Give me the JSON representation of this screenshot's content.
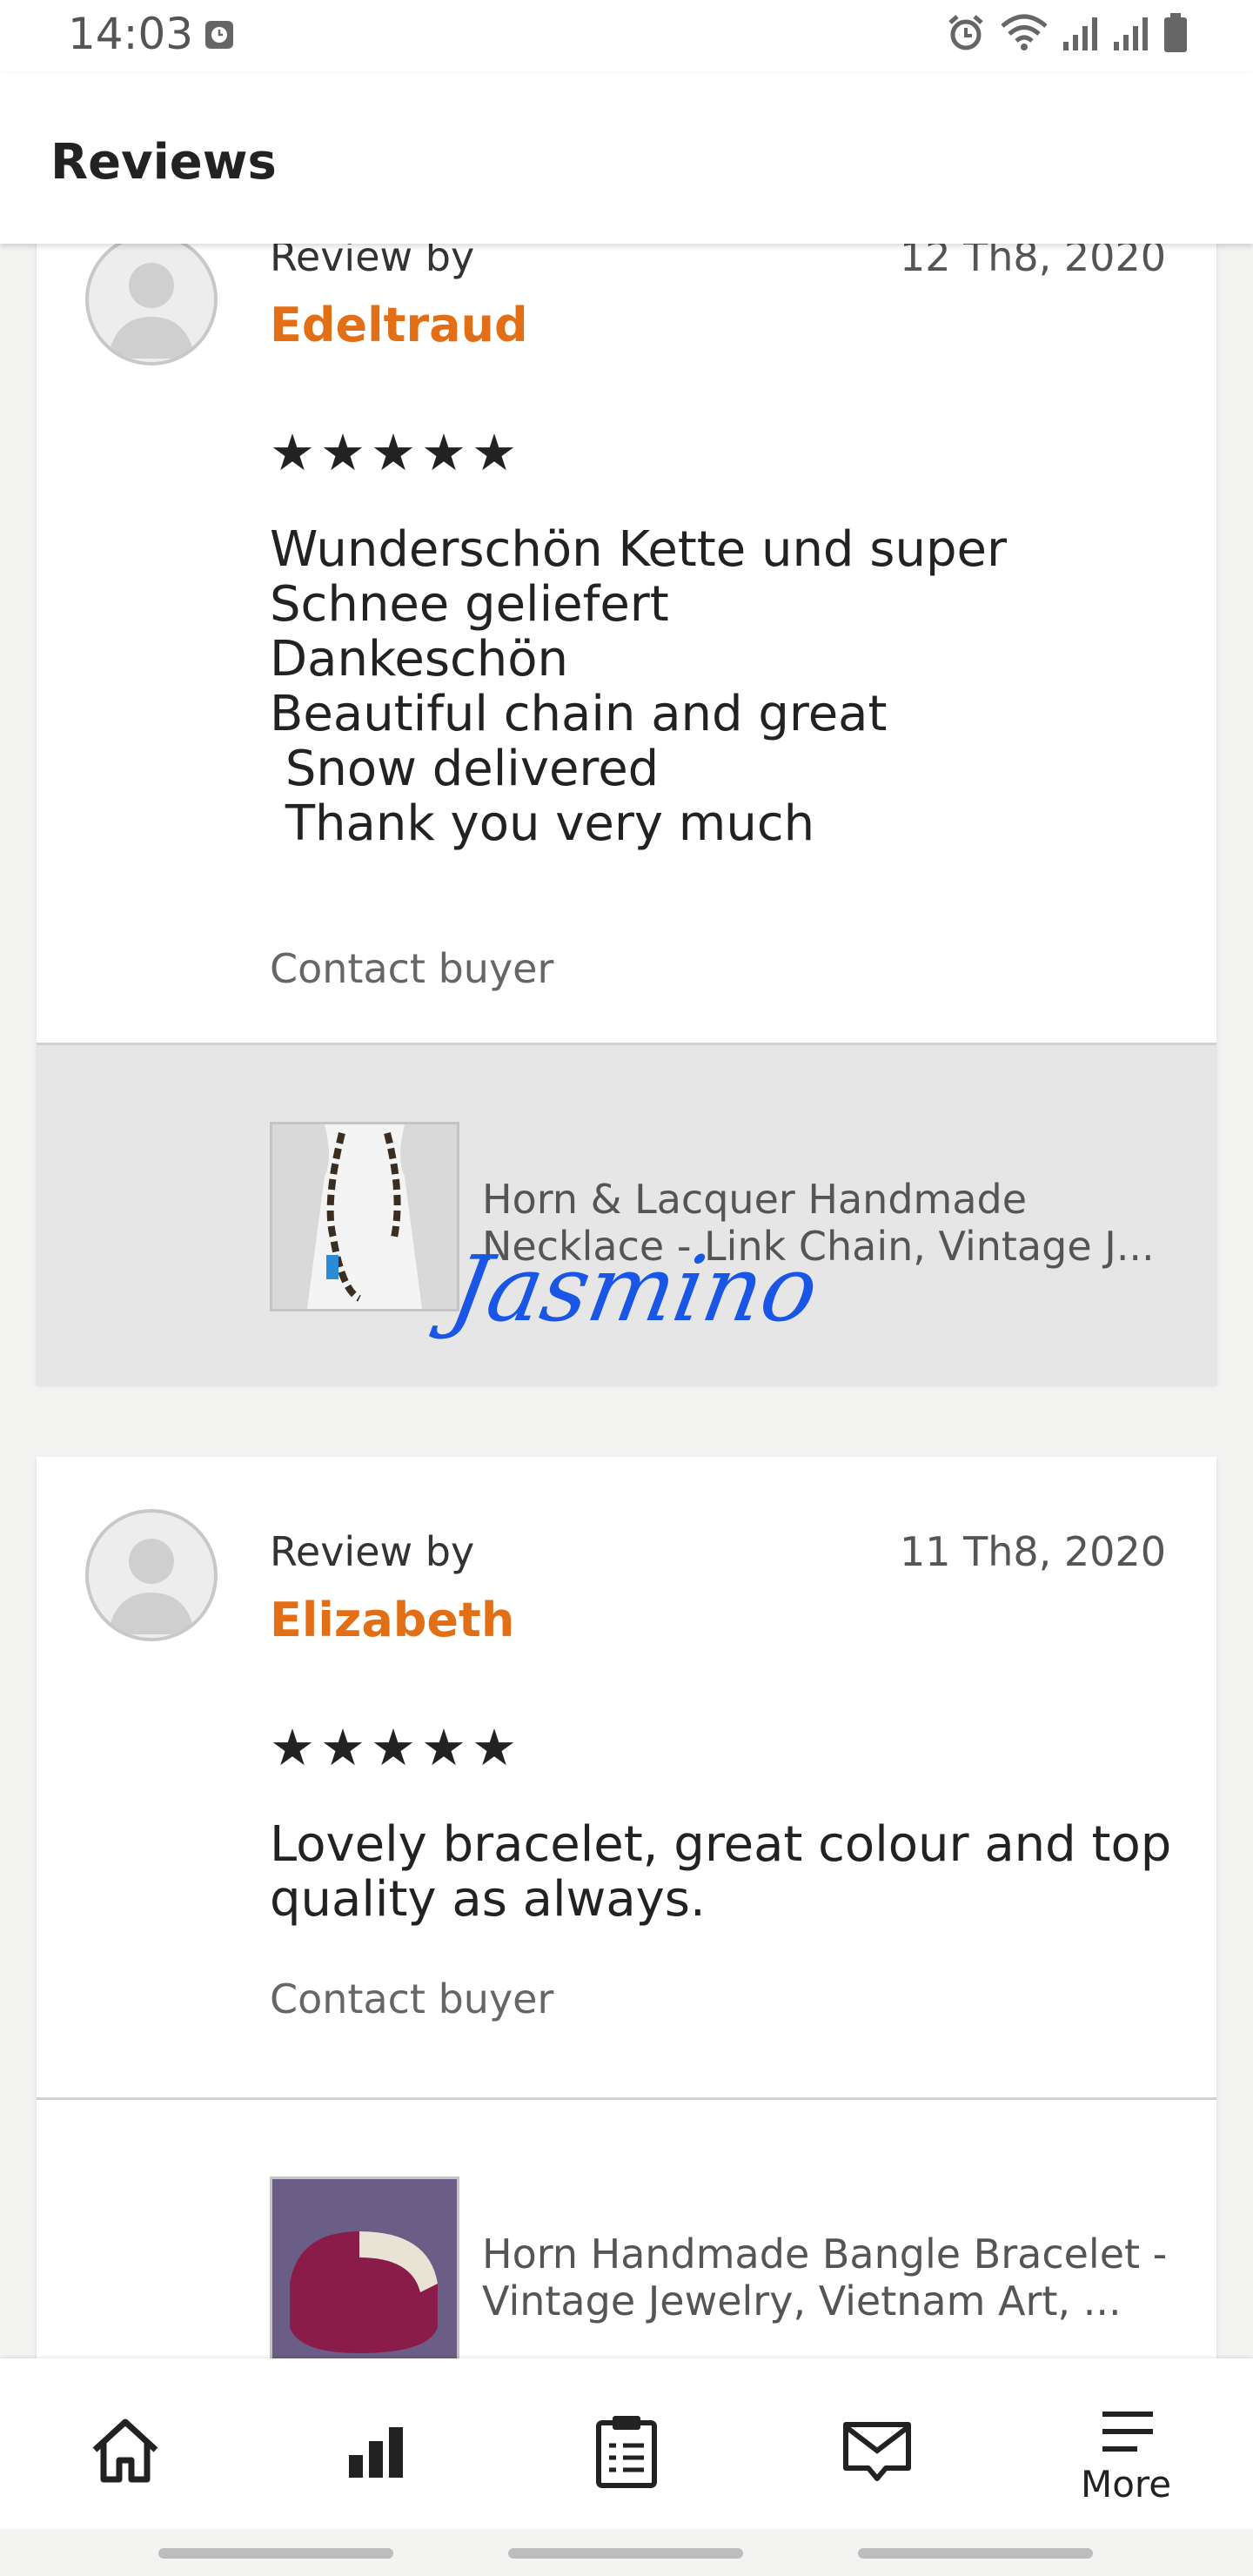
{
  "status": {
    "time": "14:03"
  },
  "header": {
    "title": "Reviews"
  },
  "reviews": [
    {
      "review_by_label": "Review by",
      "reviewer": "Edeltraud",
      "date": "12 Th8, 2020",
      "stars": "★★★★★",
      "rating": 5,
      "text": "Wunderschön Kette und super\nSchnee geliefert\nDankeschön\nBeautiful chain and great\n Snow delivered\n Thank you very much",
      "contact_label": "Contact buyer",
      "listing_title": "Horn & Lacquer Handmade Necklace - Link Chain, Vintage J..."
    },
    {
      "review_by_label": "Review by",
      "reviewer": "Elizabeth",
      "date": "11 Th8, 2020",
      "stars": "★★★★★",
      "rating": 5,
      "text": "Lovely bracelet, great colour and top quality as always.",
      "contact_label": "Contact buyer",
      "listing_title": "Horn Handmade Bangle Bracelet - Vintage Jewelry, Vietnam Art, ..."
    }
  ],
  "watermark": "Jasmino",
  "nav": {
    "more_label": "More"
  },
  "colors": {
    "accent": "#e26f16",
    "watermark": "#1a56e6"
  }
}
